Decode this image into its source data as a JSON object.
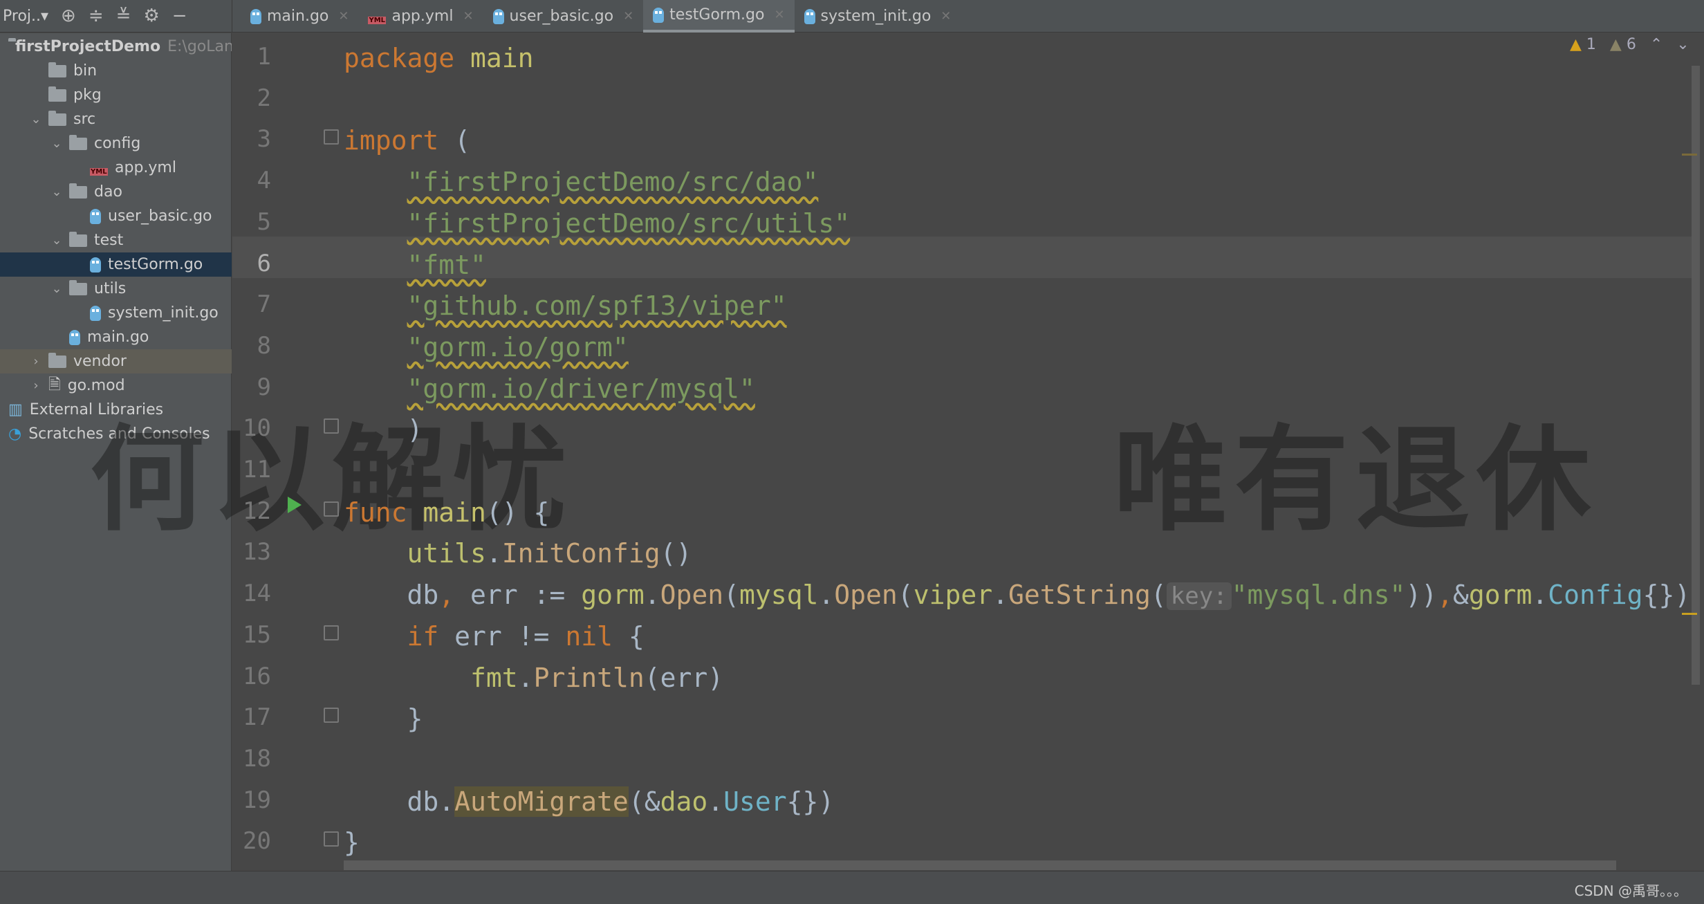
{
  "toolbar": {
    "project_label": "Proj..▾",
    "icons": [
      "locate-icon",
      "expand-all-icon",
      "collapse-all-icon",
      "gear-icon",
      "minimize-icon"
    ]
  },
  "tabs": [
    {
      "label": "main.go",
      "icon": "go-file-icon"
    },
    {
      "label": "app.yml",
      "icon": "yml-file-icon"
    },
    {
      "label": "user_basic.go",
      "icon": "go-file-icon"
    },
    {
      "label": "testGorm.go",
      "icon": "go-file-icon",
      "active": true
    },
    {
      "label": "system_init.go",
      "icon": "go-file-icon"
    }
  ],
  "tree": [
    {
      "label": "firstProjectDemo",
      "path": "E:\\goLand",
      "depth": 0,
      "type": "folder",
      "bold": true
    },
    {
      "label": "bin",
      "depth": 1,
      "type": "folder"
    },
    {
      "label": "pkg",
      "depth": 1,
      "type": "folder"
    },
    {
      "label": "src",
      "depth": 1,
      "type": "folder",
      "open": true
    },
    {
      "label": "config",
      "depth": 2,
      "type": "folder",
      "open": true
    },
    {
      "label": "app.yml",
      "depth": 3,
      "type": "yml"
    },
    {
      "label": "dao",
      "depth": 2,
      "type": "folder",
      "open": true
    },
    {
      "label": "user_basic.go",
      "depth": 3,
      "type": "go"
    },
    {
      "label": "test",
      "depth": 2,
      "type": "folder",
      "open": true
    },
    {
      "label": "testGorm.go",
      "depth": 3,
      "type": "go",
      "selected": true
    },
    {
      "label": "utils",
      "depth": 2,
      "type": "folder",
      "open": true
    },
    {
      "label": "system_init.go",
      "depth": 3,
      "type": "go"
    },
    {
      "label": "main.go",
      "depth": 2,
      "type": "go"
    },
    {
      "label": "vendor",
      "depth": 1,
      "type": "vendor",
      "closed": true
    },
    {
      "label": "go.mod",
      "depth": 1,
      "type": "mod",
      "closed": true
    },
    {
      "label": "External Libraries",
      "depth": 0,
      "type": "lib"
    },
    {
      "label": "Scratches and Consoles",
      "depth": 0,
      "type": "scratch"
    }
  ],
  "inspections": {
    "warnings": "1",
    "weak_warnings": "6"
  },
  "editor": {
    "current_line": 6,
    "lines": [
      [
        [
          "package ",
          "kw"
        ],
        [
          "main",
          "nm"
        ]
      ],
      [],
      [
        [
          "import ",
          "kw"
        ],
        [
          "(",
          "df"
        ]
      ],
      [
        [
          "    ",
          "df"
        ],
        [
          "\"firstProjectDemo/src/dao\"",
          "st"
        ]
      ],
      [
        [
          "    ",
          "df"
        ],
        [
          "\"firstProjectDemo/src/utils\"",
          "st"
        ]
      ],
      [
        [
          "    ",
          "df"
        ],
        [
          "\"fmt\"",
          "st"
        ]
      ],
      [
        [
          "    ",
          "df"
        ],
        [
          "\"github.com/spf13/viper\"",
          "st"
        ]
      ],
      [
        [
          "    ",
          "df"
        ],
        [
          "\"gorm.io/gorm\"",
          "st"
        ]
      ],
      [
        [
          "    ",
          "df"
        ],
        [
          "\"gorm.io/driver/mysql\"",
          "st"
        ]
      ],
      [
        [
          "    )",
          "df"
        ]
      ],
      [],
      [
        [
          "func ",
          "kw"
        ],
        [
          "main",
          "nm"
        ],
        [
          "() {",
          "df"
        ]
      ],
      [
        [
          "    ",
          "df"
        ],
        [
          "utils",
          "pk"
        ],
        [
          ".",
          "df"
        ],
        [
          "InitConfig",
          "fn"
        ],
        [
          "()",
          "df"
        ]
      ],
      [
        [
          "    db",
          "df"
        ],
        [
          ", ",
          "kw"
        ],
        [
          "err := ",
          "df"
        ],
        [
          "gorm",
          "pk"
        ],
        [
          ".",
          "df"
        ],
        [
          "Open",
          "fn"
        ],
        [
          "(",
          "df"
        ],
        [
          "mysql",
          "pk"
        ],
        [
          ".",
          "df"
        ],
        [
          "Open",
          "fn"
        ],
        [
          "(",
          "df"
        ],
        [
          "viper",
          "pk"
        ],
        [
          ".",
          "df"
        ],
        [
          "GetString",
          "fn"
        ],
        [
          "(",
          "df"
        ],
        [
          "key:",
          "hint"
        ],
        [
          "\"mysql.dns\"",
          "stp"
        ],
        [
          "))",
          "df"
        ],
        [
          ",",
          "kw"
        ],
        [
          "&",
          "df"
        ],
        [
          "gorm",
          "pk"
        ],
        [
          ".",
          "df"
        ],
        [
          "Config",
          "ty"
        ],
        [
          "{})",
          "df"
        ]
      ],
      [
        [
          "    ",
          "df"
        ],
        [
          "if ",
          "kw"
        ],
        [
          "err != ",
          "df"
        ],
        [
          "nil ",
          "kw"
        ],
        [
          "{",
          "df"
        ]
      ],
      [
        [
          "        ",
          "df"
        ],
        [
          "fmt",
          "pk"
        ],
        [
          ".",
          "df"
        ],
        [
          "Println",
          "fn"
        ],
        [
          "(err)",
          "df"
        ]
      ],
      [
        [
          "    }",
          "df"
        ]
      ],
      [],
      [
        [
          "    db.",
          "df"
        ],
        [
          "AutoMigrate",
          "hlfn"
        ],
        [
          "(&",
          "df"
        ],
        [
          "dao",
          "pk"
        ],
        [
          ".",
          "df"
        ],
        [
          "User",
          "ty"
        ],
        [
          "{})",
          "df"
        ]
      ],
      [
        [
          "}",
          "df"
        ]
      ]
    ]
  },
  "watermark": {
    "left": "何以解忧",
    "right": "唯有退休"
  },
  "status": {
    "credit": "CSDN @禹哥。。。"
  }
}
